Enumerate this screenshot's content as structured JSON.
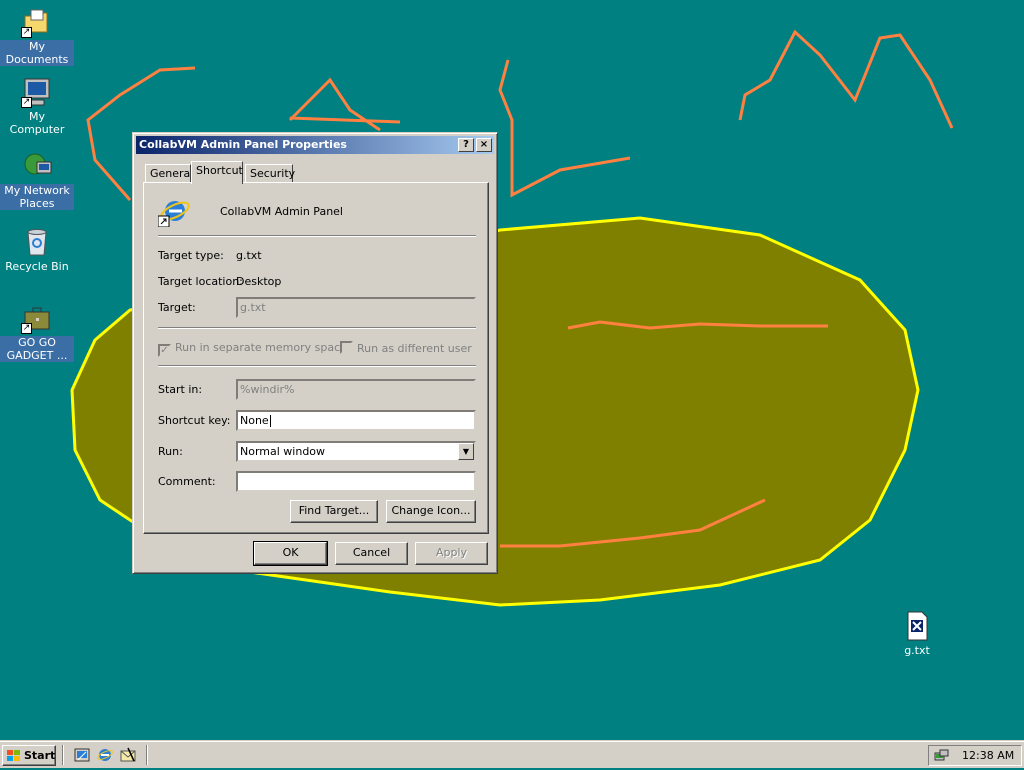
{
  "desktop": {
    "icons": [
      {
        "label": "My Documents",
        "icon": "my-documents-folder-icon"
      },
      {
        "label": "My Computer",
        "icon": "my-computer-icon"
      },
      {
        "label": "My Network Places",
        "icon": "network-places-icon"
      },
      {
        "label": "Recycle Bin",
        "icon": "recycle-bin-icon"
      },
      {
        "label": "GO GO GADGET ...",
        "icon": "briefcase-shortcut-icon"
      },
      {
        "label": "g.txt",
        "icon": "text-file-icon"
      }
    ],
    "colors": {
      "background": "#008080",
      "blob_fill": "#808000",
      "blob_stroke": "#ffff00",
      "scribble": "#ff8040"
    }
  },
  "dialog": {
    "title": "CollabVM Admin Panel Properties",
    "help_glyph": "?",
    "close_glyph": "×",
    "tabs": [
      {
        "label": "General",
        "active": false
      },
      {
        "label": "Shortcut",
        "active": true
      },
      {
        "label": "Security",
        "active": false
      }
    ],
    "shortcut_name": "CollabVM Admin Panel",
    "target_type_label": "Target type:",
    "target_type_value": "g.txt",
    "target_location_label": "Target location:",
    "target_location_value": "Desktop",
    "target_label": "Target:",
    "target_value": "g.txt",
    "separate_memory_label": "Run in separate memory space",
    "separate_memory_checked": true,
    "different_user_label": "Run as different user",
    "different_user_checked": false,
    "start_in_label": "Start in:",
    "start_in_value": "%windir%",
    "shortcut_key_label": "Shortcut key:",
    "shortcut_key_value": "None",
    "run_label": "Run:",
    "run_value": "Normal window",
    "comment_label": "Comment:",
    "comment_value": "",
    "find_target_label": "Find Target...",
    "change_icon_label": "Change Icon...",
    "ok_label": "OK",
    "cancel_label": "Cancel",
    "apply_label": "Apply"
  },
  "taskbar": {
    "start_label": "Start",
    "quick_launch": [
      "show-desktop-icon",
      "internet-explorer-icon",
      "outlook-express-icon"
    ],
    "clock": "12:38 AM"
  }
}
